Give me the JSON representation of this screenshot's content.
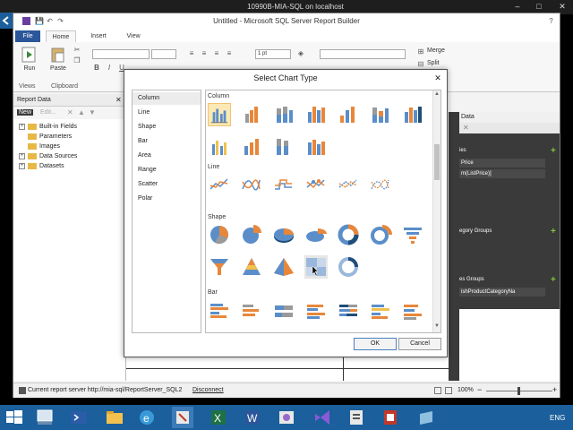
{
  "vm": {
    "title": "10990B-MIA-SQL on localhost",
    "min": "–",
    "max": "□",
    "close": "✕"
  },
  "app": {
    "title": "Untitled - Microsoft SQL Server Report Builder",
    "qa": {
      "save": "💾",
      "undo": "↶",
      "redo": "↷"
    },
    "help": "?",
    "tabs": {
      "file": "File",
      "home": "Home",
      "insert": "Insert",
      "view": "View"
    },
    "ribbon": {
      "run": "Run",
      "paste": "Paste",
      "views_group": "Views",
      "clipboard_group": "Clipboard",
      "bold": "B",
      "italic": "I",
      "underline": "U",
      "line_width": "1 pt",
      "merge": "Merge",
      "split": "Split"
    },
    "report_data": {
      "header": "Report Data",
      "close": "✕",
      "new": "New",
      "edit": "Edit...",
      "items": [
        {
          "label": "Built-in Fields",
          "pm": "+"
        },
        {
          "label": "Parameters",
          "pm": ""
        },
        {
          "label": "Images",
          "pm": ""
        },
        {
          "label": "Data Sources",
          "pm": "+"
        },
        {
          "label": "Datasets",
          "pm": "+"
        }
      ]
    },
    "right_panel": {
      "data_label": "Data",
      "values_label": "ies",
      "price": "Price",
      "sum_listprice": "m(ListPrice)]",
      "category_groups": "egory Groups",
      "series_groups": "es Groups",
      "product_cat": "ishProductCategoryNa",
      "plus": "+"
    },
    "status": {
      "server": "Current report server http://mia-sql/ReportServer_SQL2",
      "disconnect": "Disconnect",
      "zoom": "100%",
      "minus": "−",
      "plus": "+"
    }
  },
  "dialog": {
    "title": "Select Chart Type",
    "close": "✕",
    "categories": [
      "Column",
      "Line",
      "Shape",
      "Bar",
      "Area",
      "Range",
      "Scatter",
      "Polar"
    ],
    "selected_category": "Column",
    "sections": {
      "column": "Column",
      "line": "Line",
      "shape": "Shape",
      "bar": "Bar"
    },
    "ok": "OK",
    "cancel": "Cancel"
  },
  "colors": {
    "blue": "#5b8ec9",
    "orange": "#e8873a",
    "gray": "#9a9a9a",
    "navy": "#1f4e79",
    "yellow": "#f2c14e",
    "taskbar": "#1b5f9c"
  },
  "taskbar": {
    "icons": [
      "start-icon",
      "server-manager-icon",
      "powershell-icon",
      "file-explorer-icon",
      "internet-explorer-icon",
      "tools-icon",
      "excel-icon",
      "word-icon",
      "management-studio-icon",
      "visual-studio-icon",
      "report-icon",
      "pdf-icon",
      "tablet-icon"
    ],
    "lang": "ENG"
  }
}
